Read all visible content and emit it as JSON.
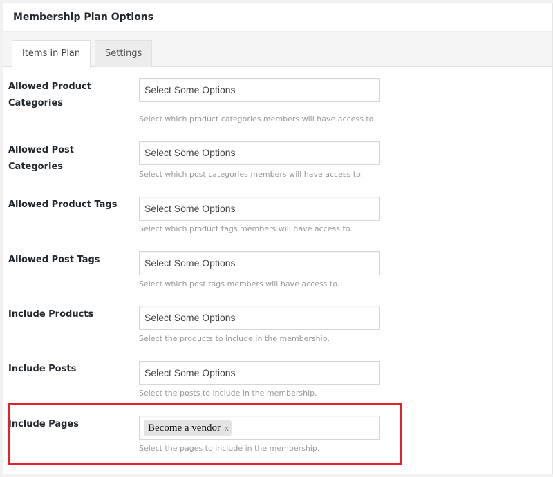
{
  "panel": {
    "title": "Membership Plan Options"
  },
  "tabs": [
    {
      "label": "Items in Plan",
      "active": true
    },
    {
      "label": "Settings",
      "active": false
    }
  ],
  "fields": [
    {
      "label": "Allowed Product Categories",
      "placeholder": "Select Some Options",
      "description": "Select which product categories members will have access to."
    },
    {
      "label": "Allowed Post Categories",
      "placeholder": "Select Some Options",
      "description": "Select which post categories members will have access to."
    },
    {
      "label": "Allowed Product Tags",
      "placeholder": "Select Some Options",
      "description": "Select which product tags members will have access to."
    },
    {
      "label": "Allowed Post Tags",
      "placeholder": "Select Some Options",
      "description": "Select which post tags members will have access to."
    },
    {
      "label": "Include Products",
      "placeholder": "Select Some Options",
      "description": "Select the products to include in the membership."
    },
    {
      "label": "Include Posts",
      "placeholder": "Select Some Options",
      "description": "Select the posts to include in the membership."
    },
    {
      "label": "Include Pages",
      "selected": [
        "Become a vendor"
      ],
      "remove_glyph": "x",
      "description": "Select the pages to include in the membership."
    }
  ],
  "colors": {
    "highlight": "#e0212e",
    "panel_bg": "#ffffff",
    "page_bg": "#f1f1f1"
  }
}
